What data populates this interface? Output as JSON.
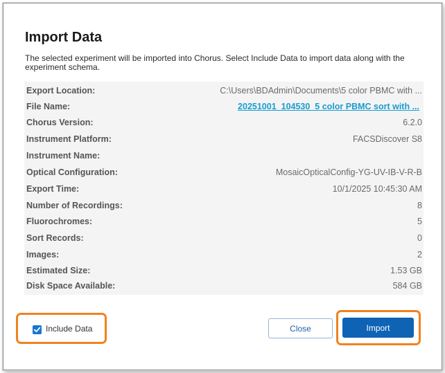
{
  "dialog": {
    "title": "Import Data",
    "description": "The selected experiment will be imported into Chorus. Select Include Data to import data along with the experiment schema."
  },
  "details": [
    {
      "label": "Export Location:",
      "value": "C:\\Users\\BDAdmin\\Documents\\5 color PBMC with ..."
    },
    {
      "label": "File Name:",
      "value": "20251001_104530_5 color PBMC sort with ..."
    },
    {
      "label": "Chorus Version:",
      "value": "6.2.0"
    },
    {
      "label": "Instrument Platform:",
      "value": "FACSDiscover S8"
    },
    {
      "label": "Instrument Name:",
      "value": ""
    },
    {
      "label": "Optical Configuration:",
      "value": "MosaicOpticalConfig-YG-UV-IB-V-R-B"
    },
    {
      "label": "Export Time:",
      "value": "10/1/2025 10:45:30 AM"
    },
    {
      "label": "Number of Recordings:",
      "value": "8"
    },
    {
      "label": "Fluorochromes:",
      "value": "5"
    },
    {
      "label": "Sort Records:",
      "value": "0"
    },
    {
      "label": "Images:",
      "value": "2"
    },
    {
      "label": "Estimated Size:",
      "value": "1.53 GB"
    },
    {
      "label": "Disk Space Available:",
      "value": "584 GB"
    }
  ],
  "include_data": {
    "label": "Include Data",
    "checked": true
  },
  "buttons": {
    "close": "Close",
    "import": "Import"
  },
  "colors": {
    "accent": "#0f63b5",
    "link": "#1a9cd0",
    "highlight": "#f0821e"
  }
}
